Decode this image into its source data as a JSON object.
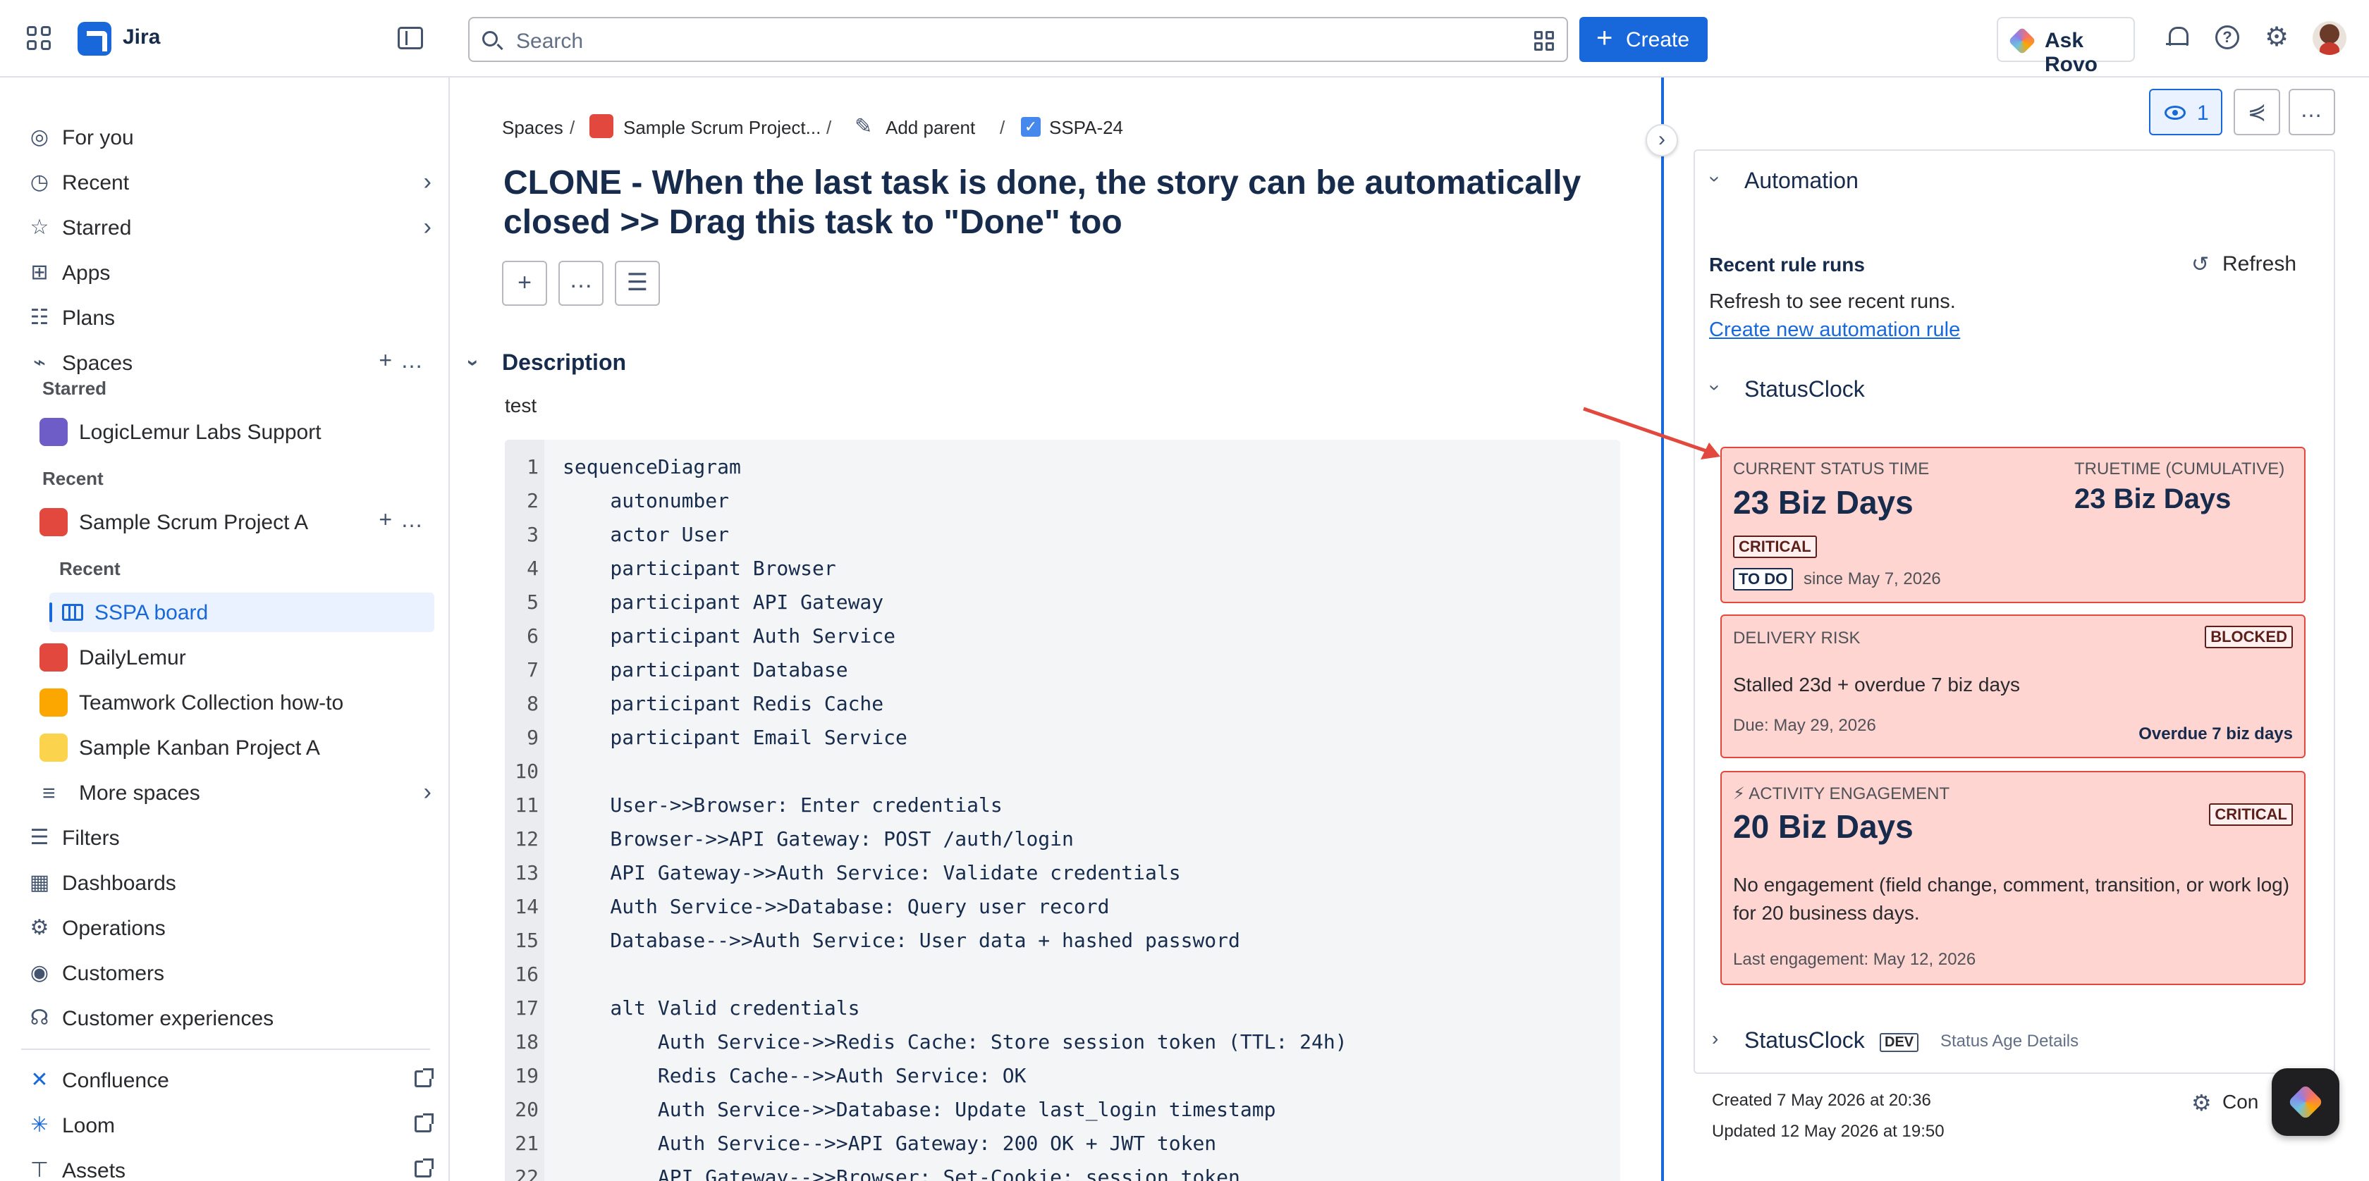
{
  "topbar": {
    "app_name": "Jira",
    "search_placeholder": "Search",
    "create_label": "Create",
    "ask_rovo_label": "Ask Rovo"
  },
  "sidebar": {
    "items": [
      {
        "label": "For you",
        "icon": "person-circle-icon"
      },
      {
        "label": "Recent",
        "icon": "clock-icon"
      },
      {
        "label": "Starred",
        "icon": "star-icon"
      },
      {
        "label": "Apps",
        "icon": "apps-icon"
      },
      {
        "label": "Plans",
        "icon": "plans-icon"
      },
      {
        "label": "Spaces",
        "icon": "spaces-icon"
      }
    ],
    "starred_heading": "Starred",
    "starred_project": "LogicLemur Labs Support",
    "recent_heading": "Recent",
    "recent_project": "Sample Scrum Project A",
    "project_recent_heading": "Recent",
    "board_label": "SSPA board",
    "other_projects": [
      "DailyLemur",
      "Teamwork Collection how-to",
      "Sample Kanban Project A"
    ],
    "more_spaces": "More spaces",
    "bottom_items": [
      {
        "label": "Filters",
        "icon": "filter-icon"
      },
      {
        "label": "Dashboards",
        "icon": "dashboard-icon"
      },
      {
        "label": "Operations",
        "icon": "operations-icon"
      },
      {
        "label": "Customers",
        "icon": "customers-icon"
      },
      {
        "label": "Customer experiences",
        "icon": "headset-icon"
      }
    ],
    "external_apps": [
      "Confluence",
      "Loom",
      "Assets"
    ]
  },
  "breadcrumb": {
    "spaces": "Spaces",
    "project": "Sample Scrum Project...",
    "add_parent": "Add parent",
    "issue_key": "SSPA-24"
  },
  "issue": {
    "title": "CLONE - When the last task is done, the story can be automatically closed >> Drag this task to \"Done\" too",
    "description_heading": "Description",
    "description_text": "test"
  },
  "code": {
    "lines": [
      "sequenceDiagram",
      "    autonumber",
      "    actor User",
      "    participant Browser",
      "    participant API Gateway",
      "    participant Auth Service",
      "    participant Database",
      "    participant Redis Cache",
      "    participant Email Service",
      "",
      "    User->>Browser: Enter credentials",
      "    Browser->>API Gateway: POST /auth/login",
      "    API Gateway->>Auth Service: Validate credentials",
      "    Auth Service->>Database: Query user record",
      "    Database-->>Auth Service: User data + hashed password",
      "",
      "    alt Valid credentials",
      "        Auth Service->>Redis Cache: Store session token (TTL: 24h)",
      "        Redis Cache-->>Auth Service: OK",
      "        Auth Service->>Database: Update last_login timestamp",
      "        Auth Service-->>API Gateway: 200 OK + JWT token",
      "        API Gateway-->>Browser: Set-Cookie: session_token"
    ]
  },
  "panel": {
    "watch_count": "1",
    "automation_heading": "Automation",
    "recent_runs_label": "Recent rule runs",
    "refresh_label": "Refresh",
    "refresh_text": "Refresh to see recent runs.",
    "create_rule_link": "Create new automation rule",
    "statusclock_heading": "StatusClock",
    "card1": {
      "label": "CURRENT STATUS TIME",
      "value": "23 Biz Days",
      "truetime_label": "TRUETIME (CUMULATIVE)",
      "truetime_value": "23 Biz Days",
      "badge": "CRITICAL",
      "status_badge": "TO DO",
      "since": "since May 7, 2026"
    },
    "card2": {
      "label": "DELIVERY RISK",
      "badge": "BLOCKED",
      "text": "Stalled 23d + overdue 7 biz days",
      "due": "Due: May 29, 2026",
      "overdue": "Overdue 7 biz days"
    },
    "card3": {
      "label": "⚡ ACTIVITY ENGAGEMENT",
      "value": "20 Biz Days",
      "badge": "CRITICAL",
      "text": "No engagement (field change, comment, transition, or work log) for 20 business days.",
      "last": "Last engagement: May 12, 2026"
    },
    "statusclock_dev_heading": "StatusClock",
    "dev_badge": "DEV",
    "status_age_label": "Status Age Details",
    "created": "Created 7 May 2026 at 20:36",
    "updated": "Updated 12 May 2026 at 19:50",
    "configure_label": "Con"
  },
  "colors": {
    "accent": "#1868db",
    "critical_bg": "#ffd5d2",
    "critical_border": "#e2483d",
    "annotation_arrow": "#e2483d"
  }
}
